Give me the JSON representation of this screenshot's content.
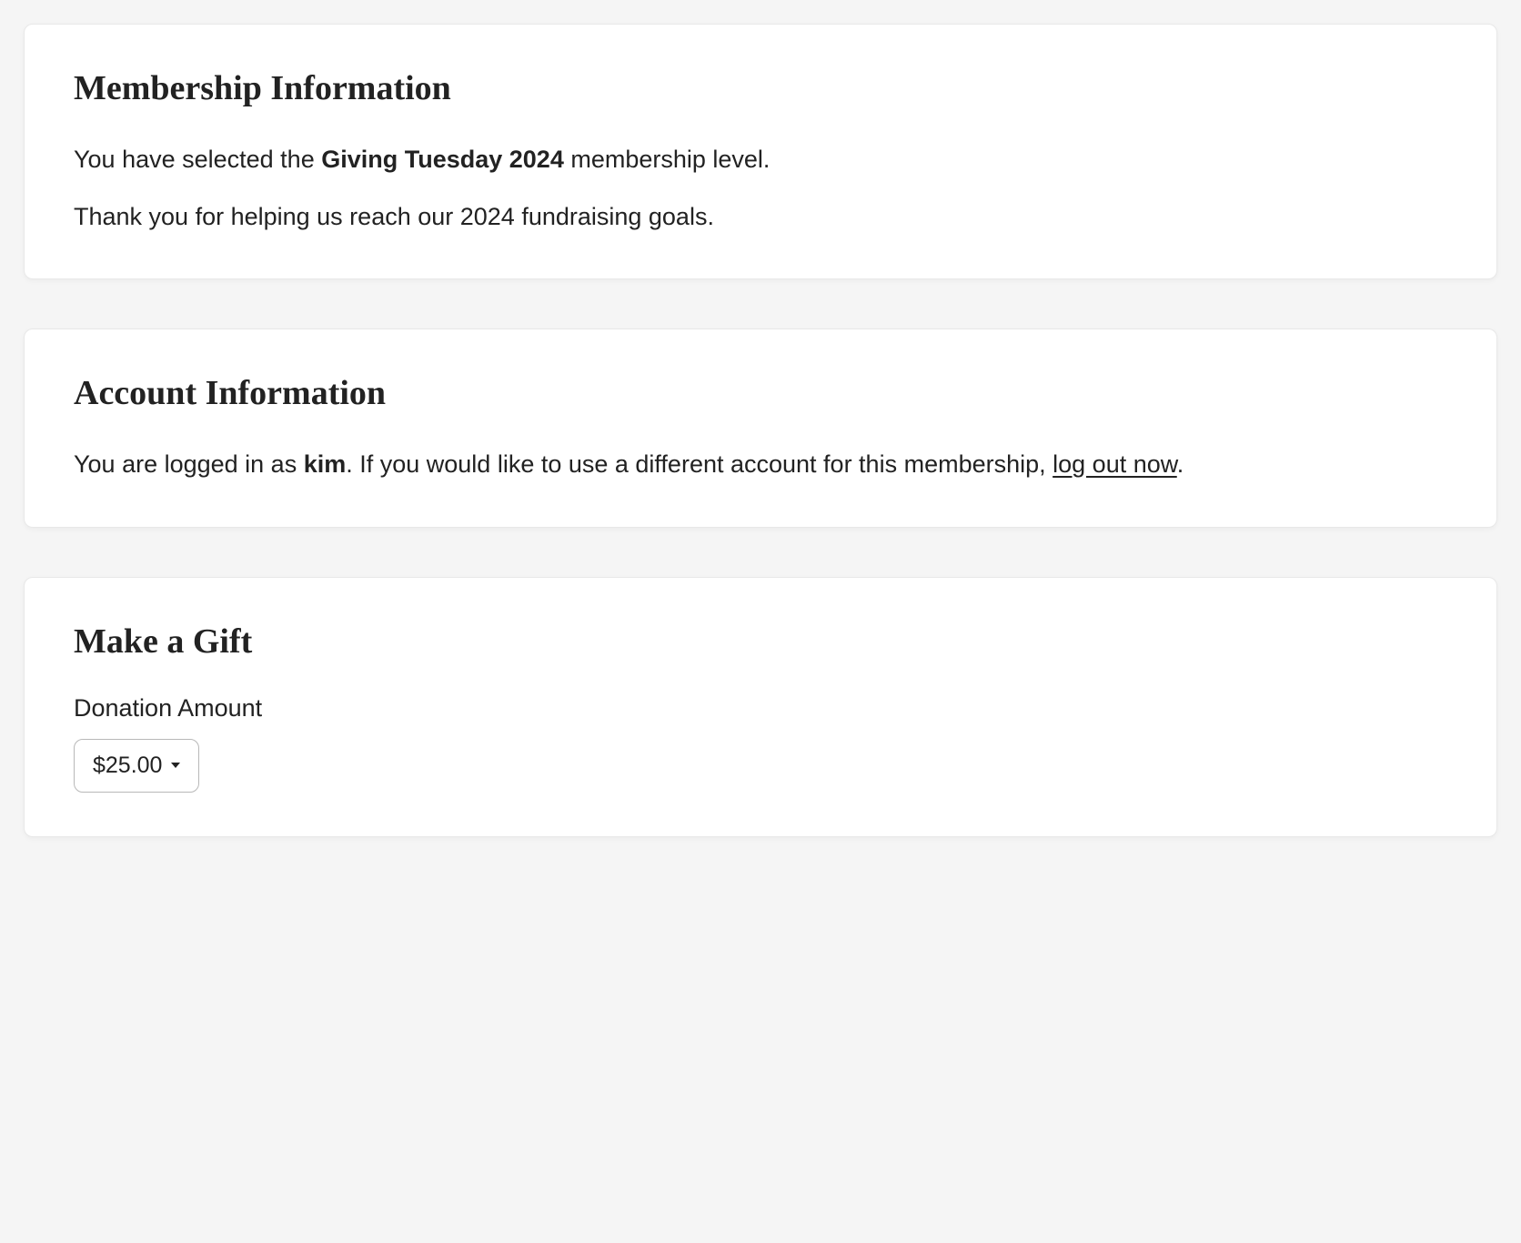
{
  "membership": {
    "heading": "Membership Information",
    "line1_prefix": "You have selected the ",
    "line1_bold": "Giving Tuesday 2024",
    "line1_suffix": " membership level.",
    "line2": "Thank you for helping us reach our 2024 fundraising goals."
  },
  "account": {
    "heading": "Account Information",
    "line1_prefix": "You are logged in as ",
    "username": "kim",
    "line1_mid": ". If you would like to use a different account for this membership, ",
    "logout_link": "log out now",
    "line1_end": "."
  },
  "gift": {
    "heading": "Make a Gift",
    "label": "Donation Amount",
    "selected": "$25.00"
  }
}
